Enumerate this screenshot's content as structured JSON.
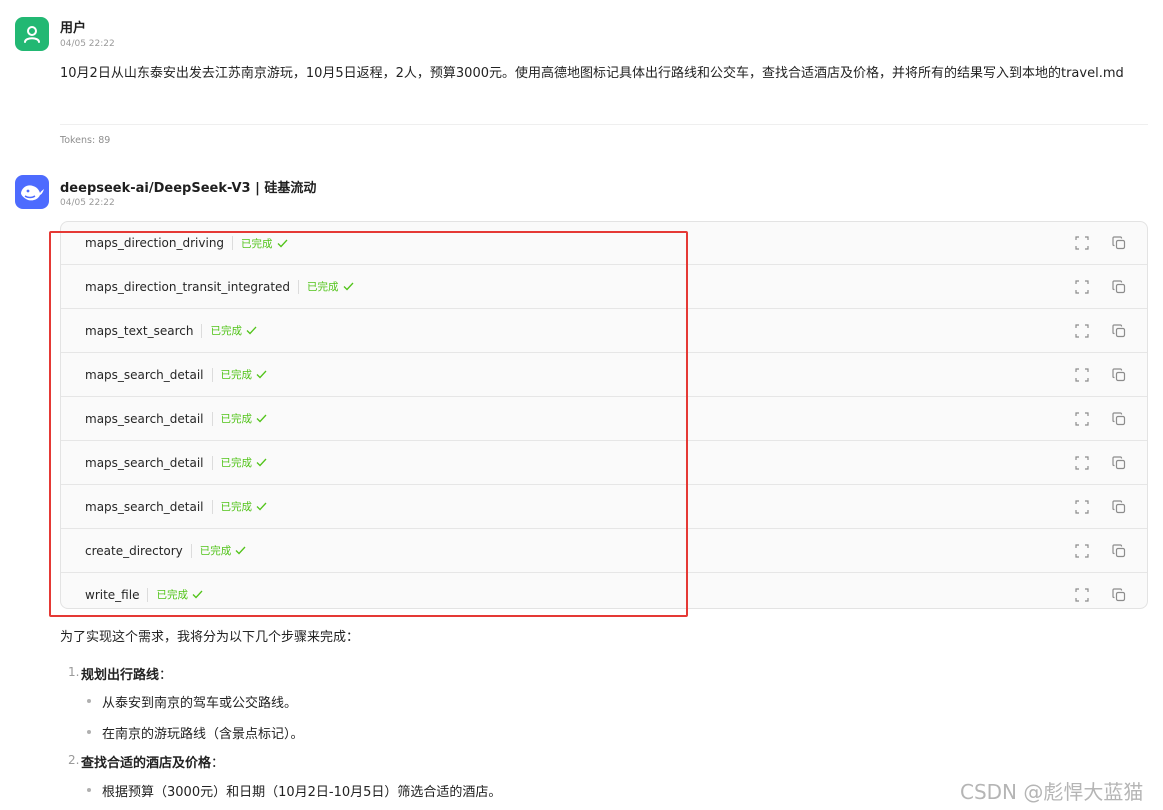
{
  "user_message": {
    "sender": "用户",
    "time": "04/05 22:22",
    "text": "10月2日从山东泰安出发去江苏南京游玩，10月5日返程，2人，预算3000元。使用高德地图标记具体出行路线和公交车，查找合适酒店及价格，并将所有的结果写入到本地的travel.md",
    "tokens": "Tokens: 89",
    "avatar_icon": "user-icon"
  },
  "assistant_message": {
    "sender": "deepseek-ai/DeepSeek-V3 | 硅基流动",
    "time": "04/05 22:22",
    "avatar_icon": "whale-logo",
    "tool_calls": [
      {
        "name": "maps_direction_driving",
        "status": "已完成"
      },
      {
        "name": "maps_direction_transit_integrated",
        "status": "已完成"
      },
      {
        "name": "maps_text_search",
        "status": "已完成"
      },
      {
        "name": "maps_search_detail",
        "status": "已完成"
      },
      {
        "name": "maps_search_detail",
        "status": "已完成"
      },
      {
        "name": "maps_search_detail",
        "status": "已完成"
      },
      {
        "name": "maps_search_detail",
        "status": "已完成"
      },
      {
        "name": "create_directory",
        "status": "已完成"
      },
      {
        "name": "write_file",
        "status": "已完成"
      }
    ],
    "intro": "为了实现这个需求，我将分为以下几个步骤来完成：",
    "steps": [
      {
        "num": "1.",
        "title": "规划出行路线",
        "colon": "：",
        "bullets": [
          "从泰安到南京的驾车或公交路线。",
          "在南京的游玩路线（含景点标记）。"
        ]
      },
      {
        "num": "2.",
        "title": "查找合适的酒店及价格",
        "colon": "：",
        "bullets": [
          "根据预算（3000元）和日期（10月2日-10月5日）筛选合适的酒店。"
        ]
      }
    ]
  },
  "watermark": "CSDN @彪悍大蓝猫",
  "colors": {
    "user_avatar": "#22b873",
    "bot_avatar": "#4d6bfe",
    "status_green": "#52c41a",
    "highlight_red": "#e53935"
  }
}
